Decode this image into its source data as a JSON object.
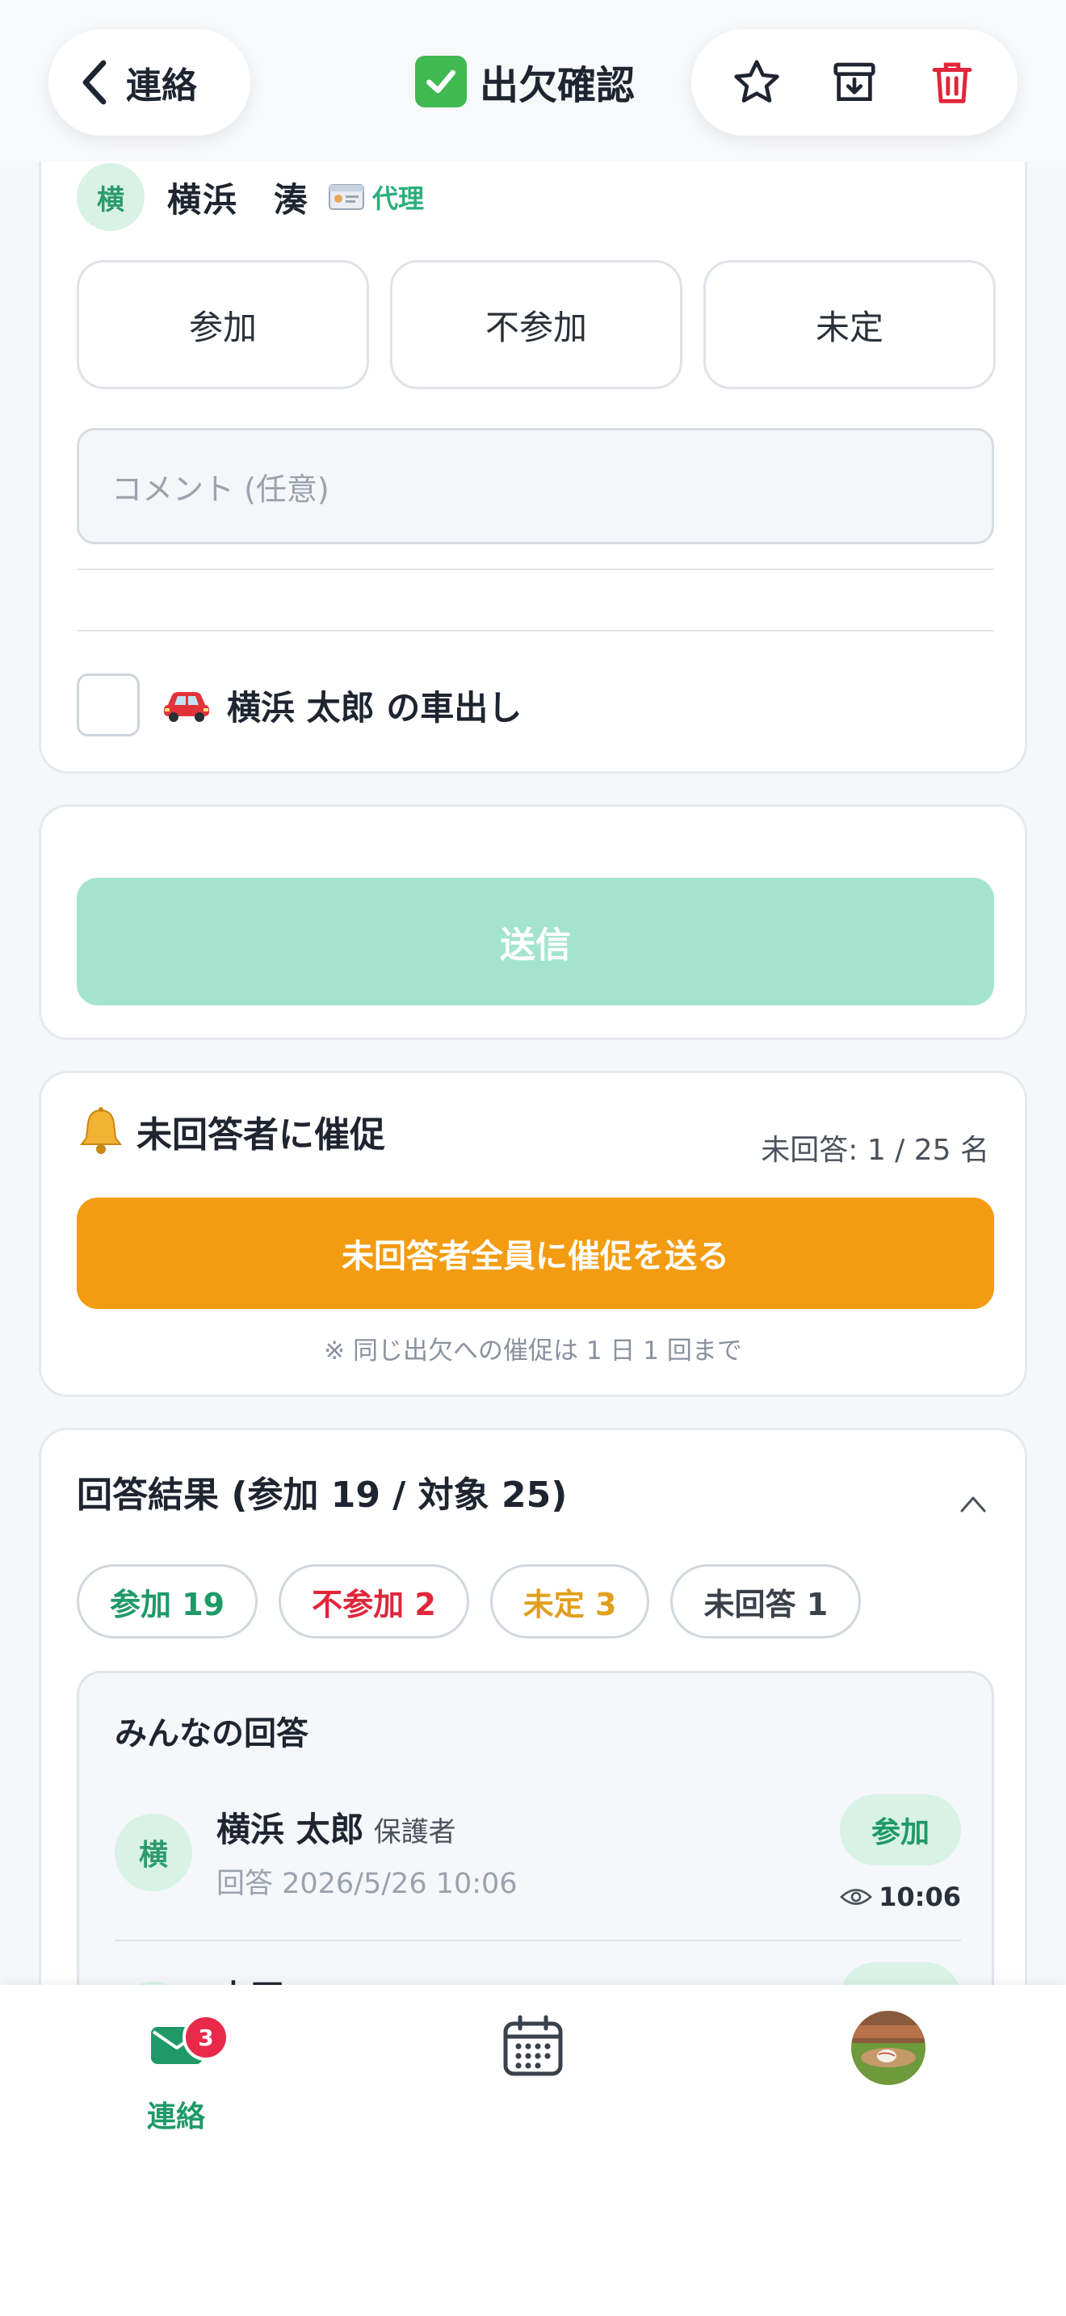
{
  "header": {
    "back_label": "連絡",
    "title": "出欠確認",
    "icons": [
      "chevron-left-icon",
      "check-box-icon",
      "star-icon",
      "archive-icon",
      "trash-icon"
    ]
  },
  "member": {
    "initial": "横",
    "name": "横浜　湊",
    "proxy_label": "代理"
  },
  "choices": [
    "参加",
    "不参加",
    "未定"
  ],
  "comment": {
    "placeholder": "コメント (任意)"
  },
  "car": {
    "label": "横浜 太郎 の車出し"
  },
  "send": {
    "label": "送信"
  },
  "reminder": {
    "title": "未回答者に催促",
    "count": "未回答: 1 / 25 名",
    "button": "未回答者全員に催促を送る",
    "note": "※ 同じ出欠への催促は 1 日 1 回まで"
  },
  "results": {
    "title": "回答結果 (参加 19 / 対象 25)",
    "chips": [
      "参加 19",
      "不参加 2",
      "未定 3",
      "未回答 1"
    ],
    "answers_title": "みんなの回答",
    "answers": [
      {
        "initial": "横",
        "name": "横浜 太郎",
        "role": "保護者",
        "time": "回答 2026/5/26 10:06",
        "status": "参加",
        "seen": "10:06"
      },
      {
        "initial": "",
        "name": "山田",
        "role": "",
        "time": "",
        "status": "参加",
        "seen": ""
      }
    ]
  },
  "tabbar": {
    "contact_label": "連絡",
    "badge": "3"
  },
  "colors": {
    "accent": "#1f9968",
    "send_disabled": "#a4e4ce",
    "remind": "#f39c12",
    "danger": "#e0263a",
    "pending": "#e0a01d"
  }
}
